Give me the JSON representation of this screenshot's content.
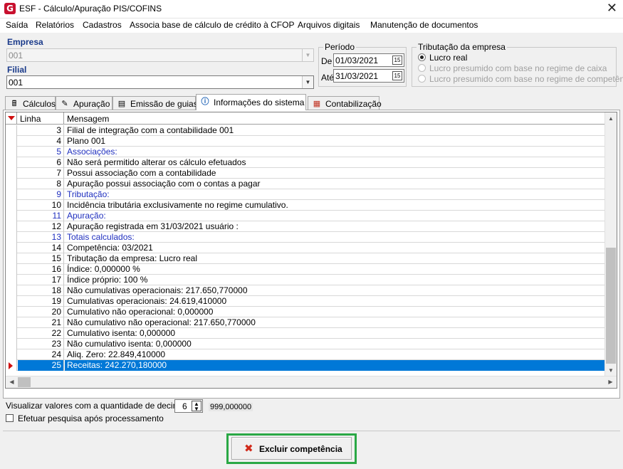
{
  "window": {
    "title": "ESF - Cálculo/Apuração PIS/COFINS",
    "logo": "G",
    "close_glyph": "✕"
  },
  "menu": [
    "Saída",
    "Relatórios",
    "Cadastros",
    "Associa base de cálculo de crédito à CFOP",
    "Arquivos digitais",
    "Manutenção de documentos"
  ],
  "empresa": {
    "label": "Empresa",
    "value": "001"
  },
  "filial": {
    "label": "Filial",
    "value": "001"
  },
  "periodo": {
    "legend": "Período",
    "de_label": "De",
    "de_value": "01/03/2021",
    "ate_label": "Até",
    "ate_value": "31/03/2021",
    "calendar_icon": "15"
  },
  "tributacao": {
    "legend": "Tributação da empresa",
    "options": [
      {
        "label": "Lucro real",
        "checked": true,
        "enabled": true
      },
      {
        "label": "Lucro presumido com base no regime de caixa",
        "checked": false,
        "enabled": false
      },
      {
        "label": "Lucro presumido com base no regime de competência",
        "checked": false,
        "enabled": false
      }
    ]
  },
  "tabs": [
    {
      "label": "Cálculos",
      "icon": "calculator-icon",
      "active": false
    },
    {
      "label": "Apuração",
      "icon": "pencil-icon",
      "active": false
    },
    {
      "label": "Emissão de guias",
      "icon": "document-icon",
      "active": false
    },
    {
      "label": "Informações do sistema",
      "icon": "info-icon",
      "active": true
    },
    {
      "label": "Contabilização",
      "icon": "calendar-icon",
      "active": false
    }
  ],
  "grid": {
    "columns": [
      "Linha",
      "Mensagem"
    ],
    "rows": [
      {
        "linha": "3",
        "mensagem": "Filial de integração com a contabilidade 001",
        "section": false
      },
      {
        "linha": "4",
        "mensagem": "Plano 001",
        "section": false
      },
      {
        "linha": "5",
        "mensagem": "Associações:",
        "section": true
      },
      {
        "linha": "6",
        "mensagem": "Não será permitido alterar os cálculo efetuados",
        "section": false
      },
      {
        "linha": "7",
        "mensagem": "Possui associação com a contabilidade",
        "section": false
      },
      {
        "linha": "8",
        "mensagem": "Apuração possui associação com o contas a pagar",
        "section": false
      },
      {
        "linha": "9",
        "mensagem": "Tributação:",
        "section": true
      },
      {
        "linha": "10",
        "mensagem": "Incidência tributária exclusivamente no regime cumulativo.",
        "section": false
      },
      {
        "linha": "11",
        "mensagem": "Apuração:",
        "section": true
      },
      {
        "linha": "12",
        "mensagem": "Apuração registrada em 31/03/2021 usuário :",
        "section": false
      },
      {
        "linha": "13",
        "mensagem": "Totais calculados:",
        "section": true
      },
      {
        "linha": "14",
        "mensagem": "Competência: 03/2021",
        "section": false
      },
      {
        "linha": "15",
        "mensagem": "Tributação da empresa: Lucro real",
        "section": false
      },
      {
        "linha": "16",
        "mensagem": "Índice: 0,000000 %",
        "section": false
      },
      {
        "linha": "17",
        "mensagem": "Índice próprio: 100 %",
        "section": false
      },
      {
        "linha": "18",
        "mensagem": "Não cumulativas operacionais: 217.650,770000",
        "section": false
      },
      {
        "linha": "19",
        "mensagem": "Cumulativas operacionais: 24.619,410000",
        "section": false
      },
      {
        "linha": "20",
        "mensagem": "Cumulativo não operacional: 0,000000",
        "section": false
      },
      {
        "linha": "21",
        "mensagem": "Não cumulativo não operacional: 217.650,770000",
        "section": false
      },
      {
        "linha": "22",
        "mensagem": "Cumulativo isenta: 0,000000",
        "section": false
      },
      {
        "linha": "23",
        "mensagem": "Não cumulativo isenta: 0,000000",
        "section": false
      },
      {
        "linha": "24",
        "mensagem": "Aliq. Zero: 22.849,410000",
        "section": false
      },
      {
        "linha": "25",
        "mensagem": "Receitas: 242.270,180000",
        "section": false,
        "selected": true
      }
    ]
  },
  "decimais": {
    "label": "Visualizar valores com a quantidade de decimais :",
    "value": "6",
    "example": "999,000000"
  },
  "pesquisa": {
    "label": "Efetuar pesquisa após processamento",
    "checked": false
  },
  "excluir_button": {
    "label": "Excluir competência",
    "icon": "delete-x-icon"
  },
  "colors": {
    "selection": "#0078d7",
    "section_text": "#1f2fbf",
    "highlight_border": "#2aa845",
    "accent_red": "#c8102e"
  }
}
